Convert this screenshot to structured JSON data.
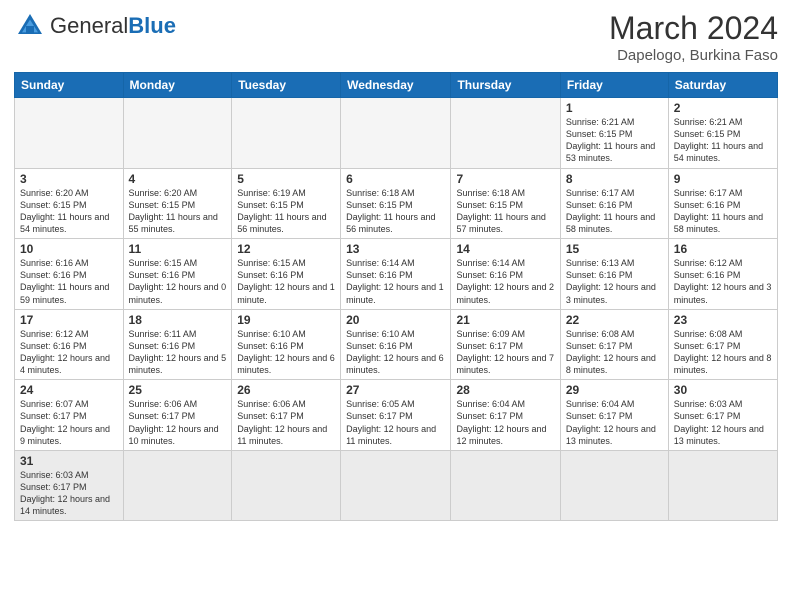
{
  "header": {
    "logo_general": "General",
    "logo_blue": "Blue",
    "month_year": "March 2024",
    "location": "Dapelogo, Burkina Faso"
  },
  "weekdays": [
    "Sunday",
    "Monday",
    "Tuesday",
    "Wednesday",
    "Thursday",
    "Friday",
    "Saturday"
  ],
  "weeks": [
    [
      {
        "day": "",
        "info": ""
      },
      {
        "day": "",
        "info": ""
      },
      {
        "day": "",
        "info": ""
      },
      {
        "day": "",
        "info": ""
      },
      {
        "day": "",
        "info": ""
      },
      {
        "day": "1",
        "info": "Sunrise: 6:21 AM\nSunset: 6:15 PM\nDaylight: 11 hours\nand 53 minutes."
      },
      {
        "day": "2",
        "info": "Sunrise: 6:21 AM\nSunset: 6:15 PM\nDaylight: 11 hours\nand 54 minutes."
      }
    ],
    [
      {
        "day": "3",
        "info": "Sunrise: 6:20 AM\nSunset: 6:15 PM\nDaylight: 11 hours\nand 54 minutes."
      },
      {
        "day": "4",
        "info": "Sunrise: 6:20 AM\nSunset: 6:15 PM\nDaylight: 11 hours\nand 55 minutes."
      },
      {
        "day": "5",
        "info": "Sunrise: 6:19 AM\nSunset: 6:15 PM\nDaylight: 11 hours\nand 56 minutes."
      },
      {
        "day": "6",
        "info": "Sunrise: 6:18 AM\nSunset: 6:15 PM\nDaylight: 11 hours\nand 56 minutes."
      },
      {
        "day": "7",
        "info": "Sunrise: 6:18 AM\nSunset: 6:15 PM\nDaylight: 11 hours\nand 57 minutes."
      },
      {
        "day": "8",
        "info": "Sunrise: 6:17 AM\nSunset: 6:16 PM\nDaylight: 11 hours\nand 58 minutes."
      },
      {
        "day": "9",
        "info": "Sunrise: 6:17 AM\nSunset: 6:16 PM\nDaylight: 11 hours\nand 58 minutes."
      }
    ],
    [
      {
        "day": "10",
        "info": "Sunrise: 6:16 AM\nSunset: 6:16 PM\nDaylight: 11 hours\nand 59 minutes."
      },
      {
        "day": "11",
        "info": "Sunrise: 6:15 AM\nSunset: 6:16 PM\nDaylight: 12 hours\nand 0 minutes."
      },
      {
        "day": "12",
        "info": "Sunrise: 6:15 AM\nSunset: 6:16 PM\nDaylight: 12 hours\nand 1 minute."
      },
      {
        "day": "13",
        "info": "Sunrise: 6:14 AM\nSunset: 6:16 PM\nDaylight: 12 hours\nand 1 minute."
      },
      {
        "day": "14",
        "info": "Sunrise: 6:14 AM\nSunset: 6:16 PM\nDaylight: 12 hours\nand 2 minutes."
      },
      {
        "day": "15",
        "info": "Sunrise: 6:13 AM\nSunset: 6:16 PM\nDaylight: 12 hours\nand 3 minutes."
      },
      {
        "day": "16",
        "info": "Sunrise: 6:12 AM\nSunset: 6:16 PM\nDaylight: 12 hours\nand 3 minutes."
      }
    ],
    [
      {
        "day": "17",
        "info": "Sunrise: 6:12 AM\nSunset: 6:16 PM\nDaylight: 12 hours\nand 4 minutes."
      },
      {
        "day": "18",
        "info": "Sunrise: 6:11 AM\nSunset: 6:16 PM\nDaylight: 12 hours\nand 5 minutes."
      },
      {
        "day": "19",
        "info": "Sunrise: 6:10 AM\nSunset: 6:16 PM\nDaylight: 12 hours\nand 6 minutes."
      },
      {
        "day": "20",
        "info": "Sunrise: 6:10 AM\nSunset: 6:16 PM\nDaylight: 12 hours\nand 6 minutes."
      },
      {
        "day": "21",
        "info": "Sunrise: 6:09 AM\nSunset: 6:17 PM\nDaylight: 12 hours\nand 7 minutes."
      },
      {
        "day": "22",
        "info": "Sunrise: 6:08 AM\nSunset: 6:17 PM\nDaylight: 12 hours\nand 8 minutes."
      },
      {
        "day": "23",
        "info": "Sunrise: 6:08 AM\nSunset: 6:17 PM\nDaylight: 12 hours\nand 8 minutes."
      }
    ],
    [
      {
        "day": "24",
        "info": "Sunrise: 6:07 AM\nSunset: 6:17 PM\nDaylight: 12 hours\nand 9 minutes."
      },
      {
        "day": "25",
        "info": "Sunrise: 6:06 AM\nSunset: 6:17 PM\nDaylight: 12 hours\nand 10 minutes."
      },
      {
        "day": "26",
        "info": "Sunrise: 6:06 AM\nSunset: 6:17 PM\nDaylight: 12 hours\nand 11 minutes."
      },
      {
        "day": "27",
        "info": "Sunrise: 6:05 AM\nSunset: 6:17 PM\nDaylight: 12 hours\nand 11 minutes."
      },
      {
        "day": "28",
        "info": "Sunrise: 6:04 AM\nSunset: 6:17 PM\nDaylight: 12 hours\nand 12 minutes."
      },
      {
        "day": "29",
        "info": "Sunrise: 6:04 AM\nSunset: 6:17 PM\nDaylight: 12 hours\nand 13 minutes."
      },
      {
        "day": "30",
        "info": "Sunrise: 6:03 AM\nSunset: 6:17 PM\nDaylight: 12 hours\nand 13 minutes."
      }
    ],
    [
      {
        "day": "31",
        "info": "Sunrise: 6:03 AM\nSunset: 6:17 PM\nDaylight: 12 hours\nand 14 minutes."
      },
      {
        "day": "",
        "info": ""
      },
      {
        "day": "",
        "info": ""
      },
      {
        "day": "",
        "info": ""
      },
      {
        "day": "",
        "info": ""
      },
      {
        "day": "",
        "info": ""
      },
      {
        "day": "",
        "info": ""
      }
    ]
  ]
}
